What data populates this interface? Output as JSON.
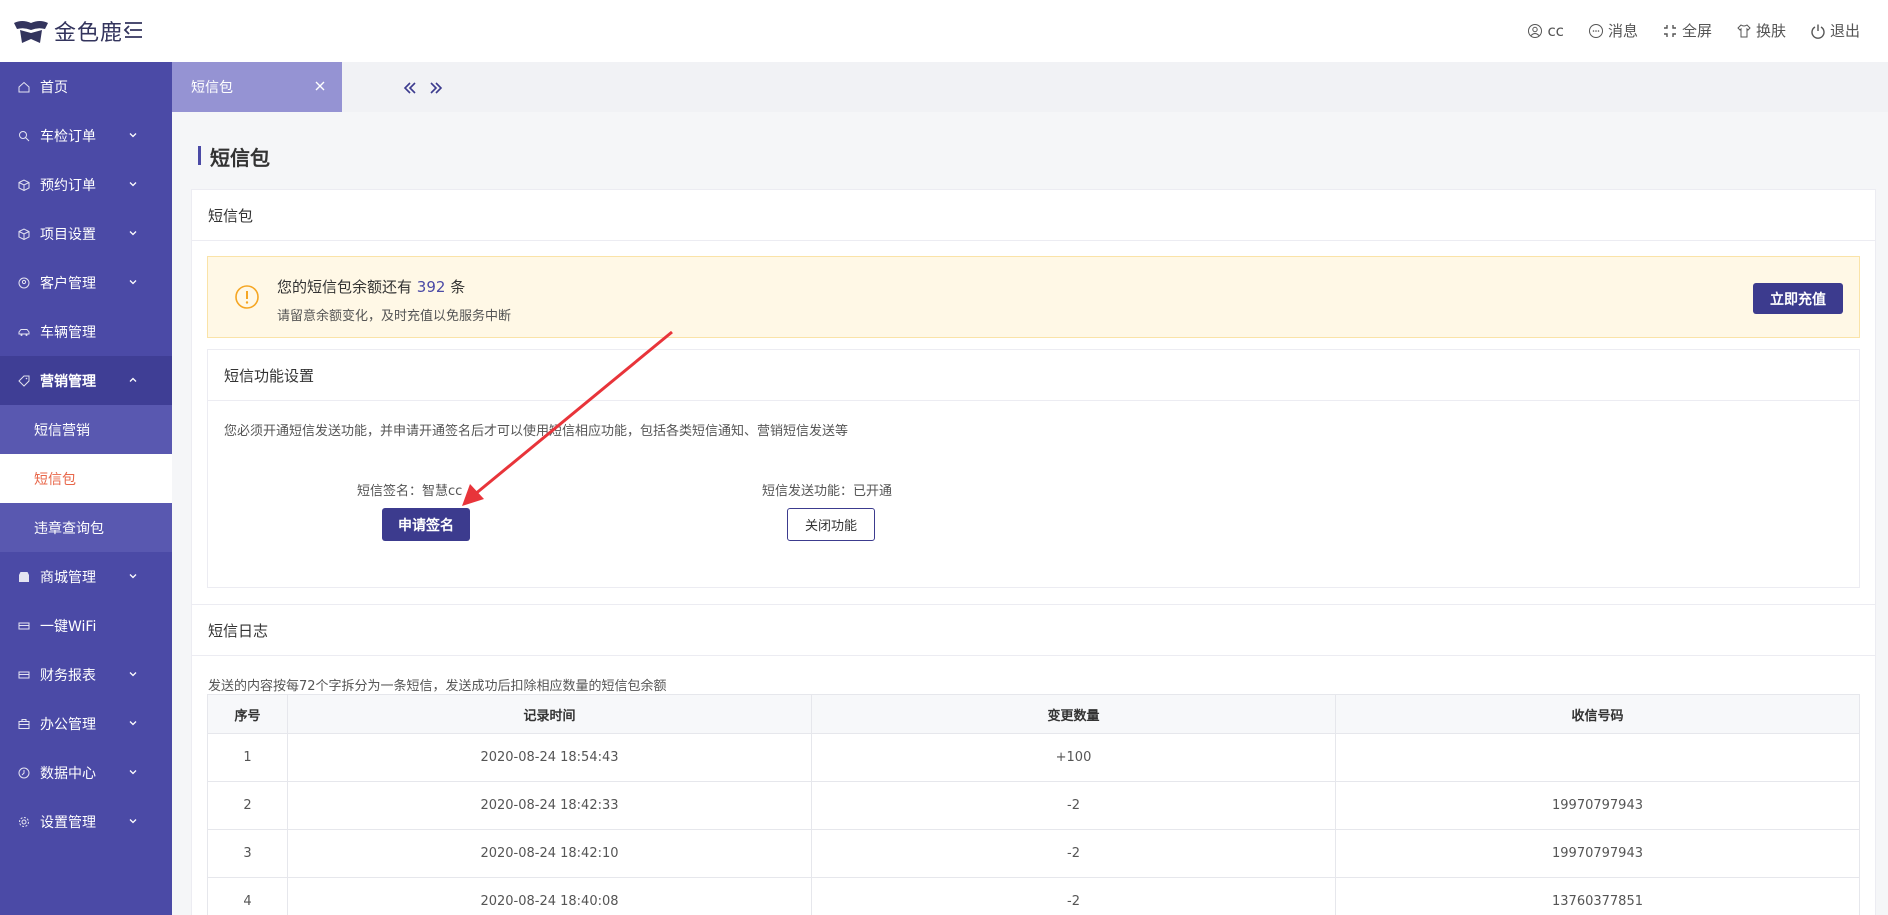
{
  "brand": {
    "name": "金色鹿"
  },
  "topbar": {
    "user": "cc",
    "messages": "消息",
    "fullscreen": "全屏",
    "theme": "换肤",
    "logout": "退出"
  },
  "sidebar": {
    "items": [
      {
        "label": "首页"
      },
      {
        "label": "车检订单"
      },
      {
        "label": "预约订单"
      },
      {
        "label": "项目设置"
      },
      {
        "label": "客户管理"
      },
      {
        "label": "车辆管理"
      },
      {
        "label": "营销管理"
      },
      {
        "label": "商城管理"
      },
      {
        "label": "一键WiFi"
      },
      {
        "label": "财务报表"
      },
      {
        "label": "办公管理"
      },
      {
        "label": "数据中心"
      },
      {
        "label": "设置管理"
      }
    ],
    "submenu": [
      {
        "label": "短信营销"
      },
      {
        "label": "短信包"
      },
      {
        "label": "违章查询包"
      }
    ]
  },
  "tabs": [
    {
      "label": "短信包"
    }
  ],
  "page": {
    "title": "短信包"
  },
  "panel": {
    "title": "短信包",
    "notice": {
      "prefix": "您的短信包余额还有",
      "balance": "392",
      "suffix": "条",
      "sub": "请留意余额变化，及时充值以免服务中断",
      "recharge": "立即充值"
    },
    "func": {
      "title": "短信功能设置",
      "desc": "您必须开通短信发送功能，并申请开通签名后才可以使用短信相应功能，包括各类短信通知、营销短信发送等",
      "signature_label": "短信签名：智慧cc",
      "apply_button": "申请签名",
      "send_label": "短信发送功能：已开通",
      "close_button": "关闭功能"
    }
  },
  "log": {
    "title": "短信日志",
    "desc": "发送的内容按每72个字拆分为一条短信，发送成功后扣除相应数量的短信包余额",
    "columns": [
      "序号",
      "记录时间",
      "变更数量",
      "收信号码"
    ],
    "rows": [
      [
        "1",
        "2020-08-24 18:54:43",
        "+100",
        ""
      ],
      [
        "2",
        "2020-08-24 18:42:33",
        "-2",
        "19970797943"
      ],
      [
        "3",
        "2020-08-24 18:42:10",
        "-2",
        "19970797943"
      ],
      [
        "4",
        "2020-08-24 18:40:08",
        "-2",
        "13760377851"
      ]
    ]
  },
  "colors": {
    "accent": "#4b4aa6",
    "button": "#3c3b8e",
    "active_text": "#e8674a",
    "annotation_arrow": "#e8343a"
  }
}
